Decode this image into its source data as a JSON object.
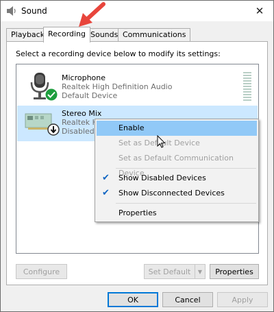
{
  "window": {
    "title": "Sound",
    "close_glyph": "✕"
  },
  "tabs": [
    {
      "label": "Playback"
    },
    {
      "label": "Recording"
    },
    {
      "label": "Sounds"
    },
    {
      "label": "Communications"
    }
  ],
  "recording": {
    "instruction": "Select a recording device below to modify its settings:",
    "devices": [
      {
        "name": "Microphone",
        "driver": "Realtek High Definition Audio",
        "status": "Default Device",
        "icon": "microphone-icon",
        "badge": "default-check-icon"
      },
      {
        "name": "Stereo Mix",
        "driver": "Realtek Hi",
        "status": "Disabled",
        "icon": "sound-card-icon",
        "badge": "disabled-arrow-icon"
      }
    ]
  },
  "context_menu": {
    "items": [
      {
        "label": "Enable",
        "checked": false,
        "disabled": false,
        "highlighted": true
      },
      {
        "label": "Set as Default Device",
        "checked": false,
        "disabled": true
      },
      {
        "label": "Set as Default Communication Device",
        "checked": false,
        "disabled": true
      },
      {
        "label": "Show Disabled Devices",
        "checked": true,
        "disabled": false
      },
      {
        "label": "Show Disconnected Devices",
        "checked": true,
        "disabled": false
      },
      {
        "label": "Properties",
        "checked": false,
        "disabled": false
      }
    ]
  },
  "panel_buttons": {
    "configure": "Configure",
    "set_default": "Set Default",
    "properties": "Properties"
  },
  "dialog_buttons": {
    "ok": "OK",
    "cancel": "Cancel",
    "apply": "Apply"
  },
  "colors": {
    "selection": "#cce8ff",
    "menu_highlight": "#91c9f7",
    "annotation_arrow": "#e8453c",
    "check_green": "#1e9e3e"
  }
}
